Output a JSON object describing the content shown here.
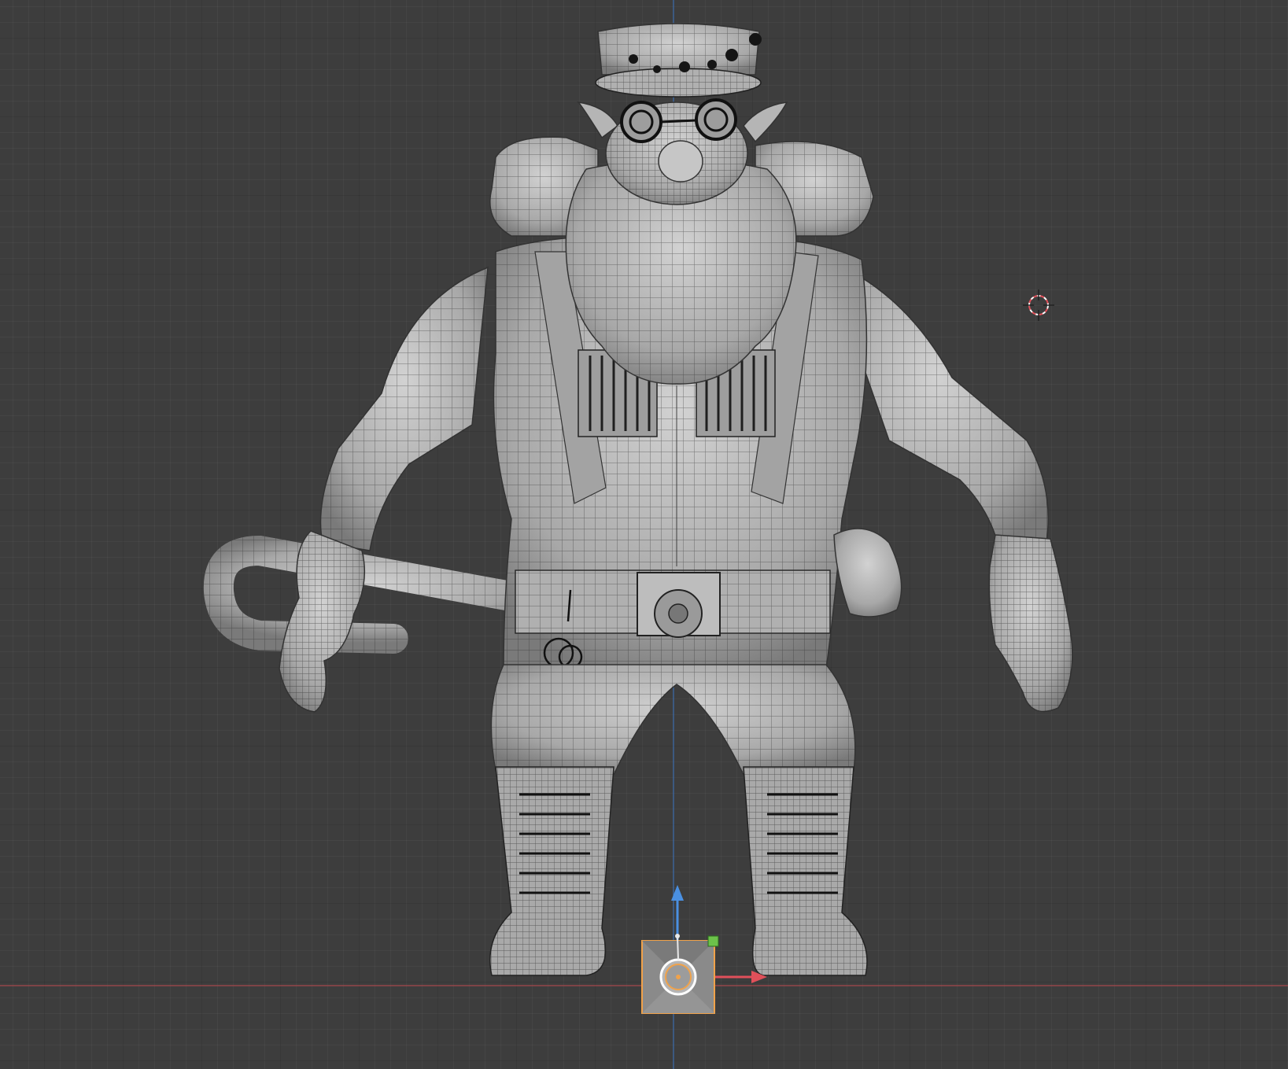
{
  "viewport": {
    "background_color": "#3d3d3d",
    "grid_color": "#2f2f2f",
    "x_axis_color": "#c04a4f",
    "y_axis_color": "#3f7fd6"
  },
  "model": {
    "mesh_color": "#b9b9b9",
    "wire_color": "#2a2a2a",
    "shading": "wireframe-overlay"
  },
  "origin_gizmo": {
    "box_color": "#8a8a8a",
    "outline_color": "#f0a24a",
    "up_arrow_color": "#4a90e2",
    "right_arrow_color": "#e0505a",
    "corner_handle_color": "#6cc24a"
  },
  "icons": [
    "3d-cursor-icon",
    "origin-gizmo-icon"
  ]
}
